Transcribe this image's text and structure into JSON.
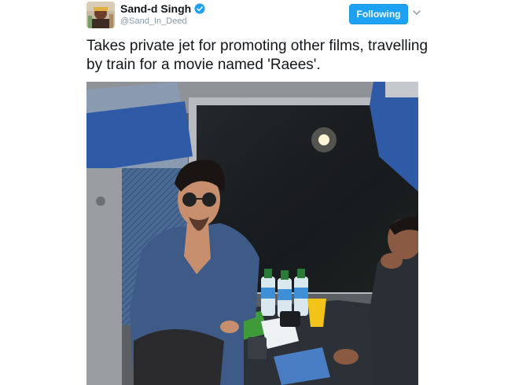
{
  "tweet": {
    "author": {
      "display_name": "Sand-d Singh",
      "handle": "@Sand_In_Deed",
      "verified": true,
      "avatar": "avatar-image"
    },
    "follow_button_label": "Following",
    "menu_icon": "chevron-down-icon",
    "text": "Takes private jet for promoting other films, travelling by train for a movie named 'Raees'.",
    "media": {
      "description": "photo-in-train-compartment"
    }
  },
  "colors": {
    "brand_blue": "#1da1f2",
    "name_text": "#14171a",
    "handle_text": "#8899a6"
  }
}
